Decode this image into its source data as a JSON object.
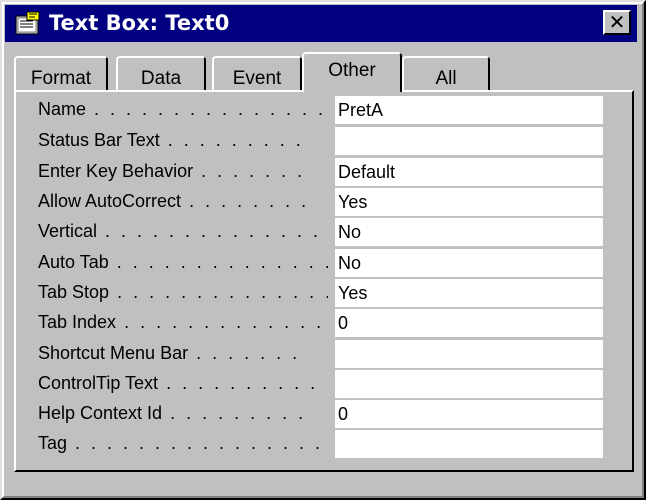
{
  "window": {
    "title": "Text Box: Text0",
    "close_glyph": "✕",
    "icon": "properties-sheet-icon"
  },
  "tabs": [
    {
      "label": "Format",
      "active": false
    },
    {
      "label": "Data",
      "active": false
    },
    {
      "label": "Event",
      "active": false
    },
    {
      "label": "Other",
      "active": true
    },
    {
      "label": "All",
      "active": false
    }
  ],
  "properties": [
    {
      "label": "Name",
      "dots": " . . . . . . . . . . . . . . . . .",
      "value": "PretA"
    },
    {
      "label": "Status Bar Text",
      "dots": " . . . . . . . . .",
      "value": ""
    },
    {
      "label": "Enter Key Behavior",
      "dots": " . . . . . . .",
      "value": "Default"
    },
    {
      "label": "Allow AutoCorrect",
      "dots": " . . . . . . . .",
      "value": "Yes"
    },
    {
      "label": "Vertical",
      "dots": " . . . . . . . . . . . . . . .",
      "value": "No"
    },
    {
      "label": "Auto Tab",
      "dots": " . . . . . . . . . . . . . .",
      "value": "No"
    },
    {
      "label": "Tab Stop",
      "dots": " . . . . . . . . . . . . . .",
      "value": "Yes"
    },
    {
      "label": "Tab Index",
      "dots": " . . . . . . . . . . . . .",
      "value": "0"
    },
    {
      "label": "Shortcut Menu Bar",
      "dots": " . . . . . . .",
      "value": ""
    },
    {
      "label": "ControlTip Text",
      "dots": " . . . . . . . . . .",
      "value": ""
    },
    {
      "label": "Help Context Id",
      "dots": " . . . . . . . . .",
      "value": "0"
    },
    {
      "label": "Tag",
      "dots": " . . . . . . . . . . . . . . . . . . .",
      "value": ""
    }
  ],
  "colors": {
    "titlebar": "#000080",
    "face": "#c0c0c0",
    "field": "#ffffff"
  }
}
